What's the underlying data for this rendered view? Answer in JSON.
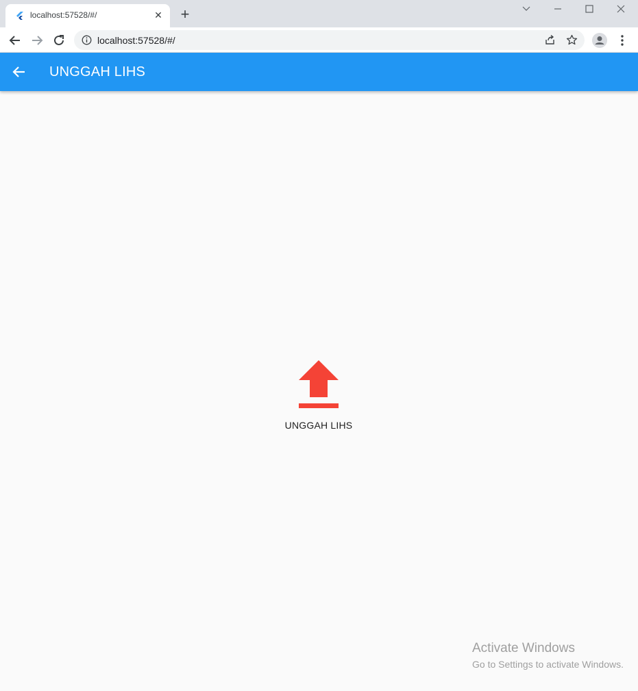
{
  "browser": {
    "tab_title": "localhost:57528/#/",
    "tab_close": "✕",
    "new_tab": "+",
    "url": "localhost:57528/#/",
    "window_controls": [
      "chevron-down",
      "minimize",
      "maximize",
      "close"
    ]
  },
  "appbar": {
    "title": "UNGGAH LIHS",
    "color": "#2196f3"
  },
  "main": {
    "upload_label": "UNGGAH LIHS",
    "upload_icon": "upload-icon",
    "icon_color": "#f44336"
  },
  "watermark": {
    "title": "Activate Windows",
    "subtitle": "Go to Settings to activate Windows."
  }
}
